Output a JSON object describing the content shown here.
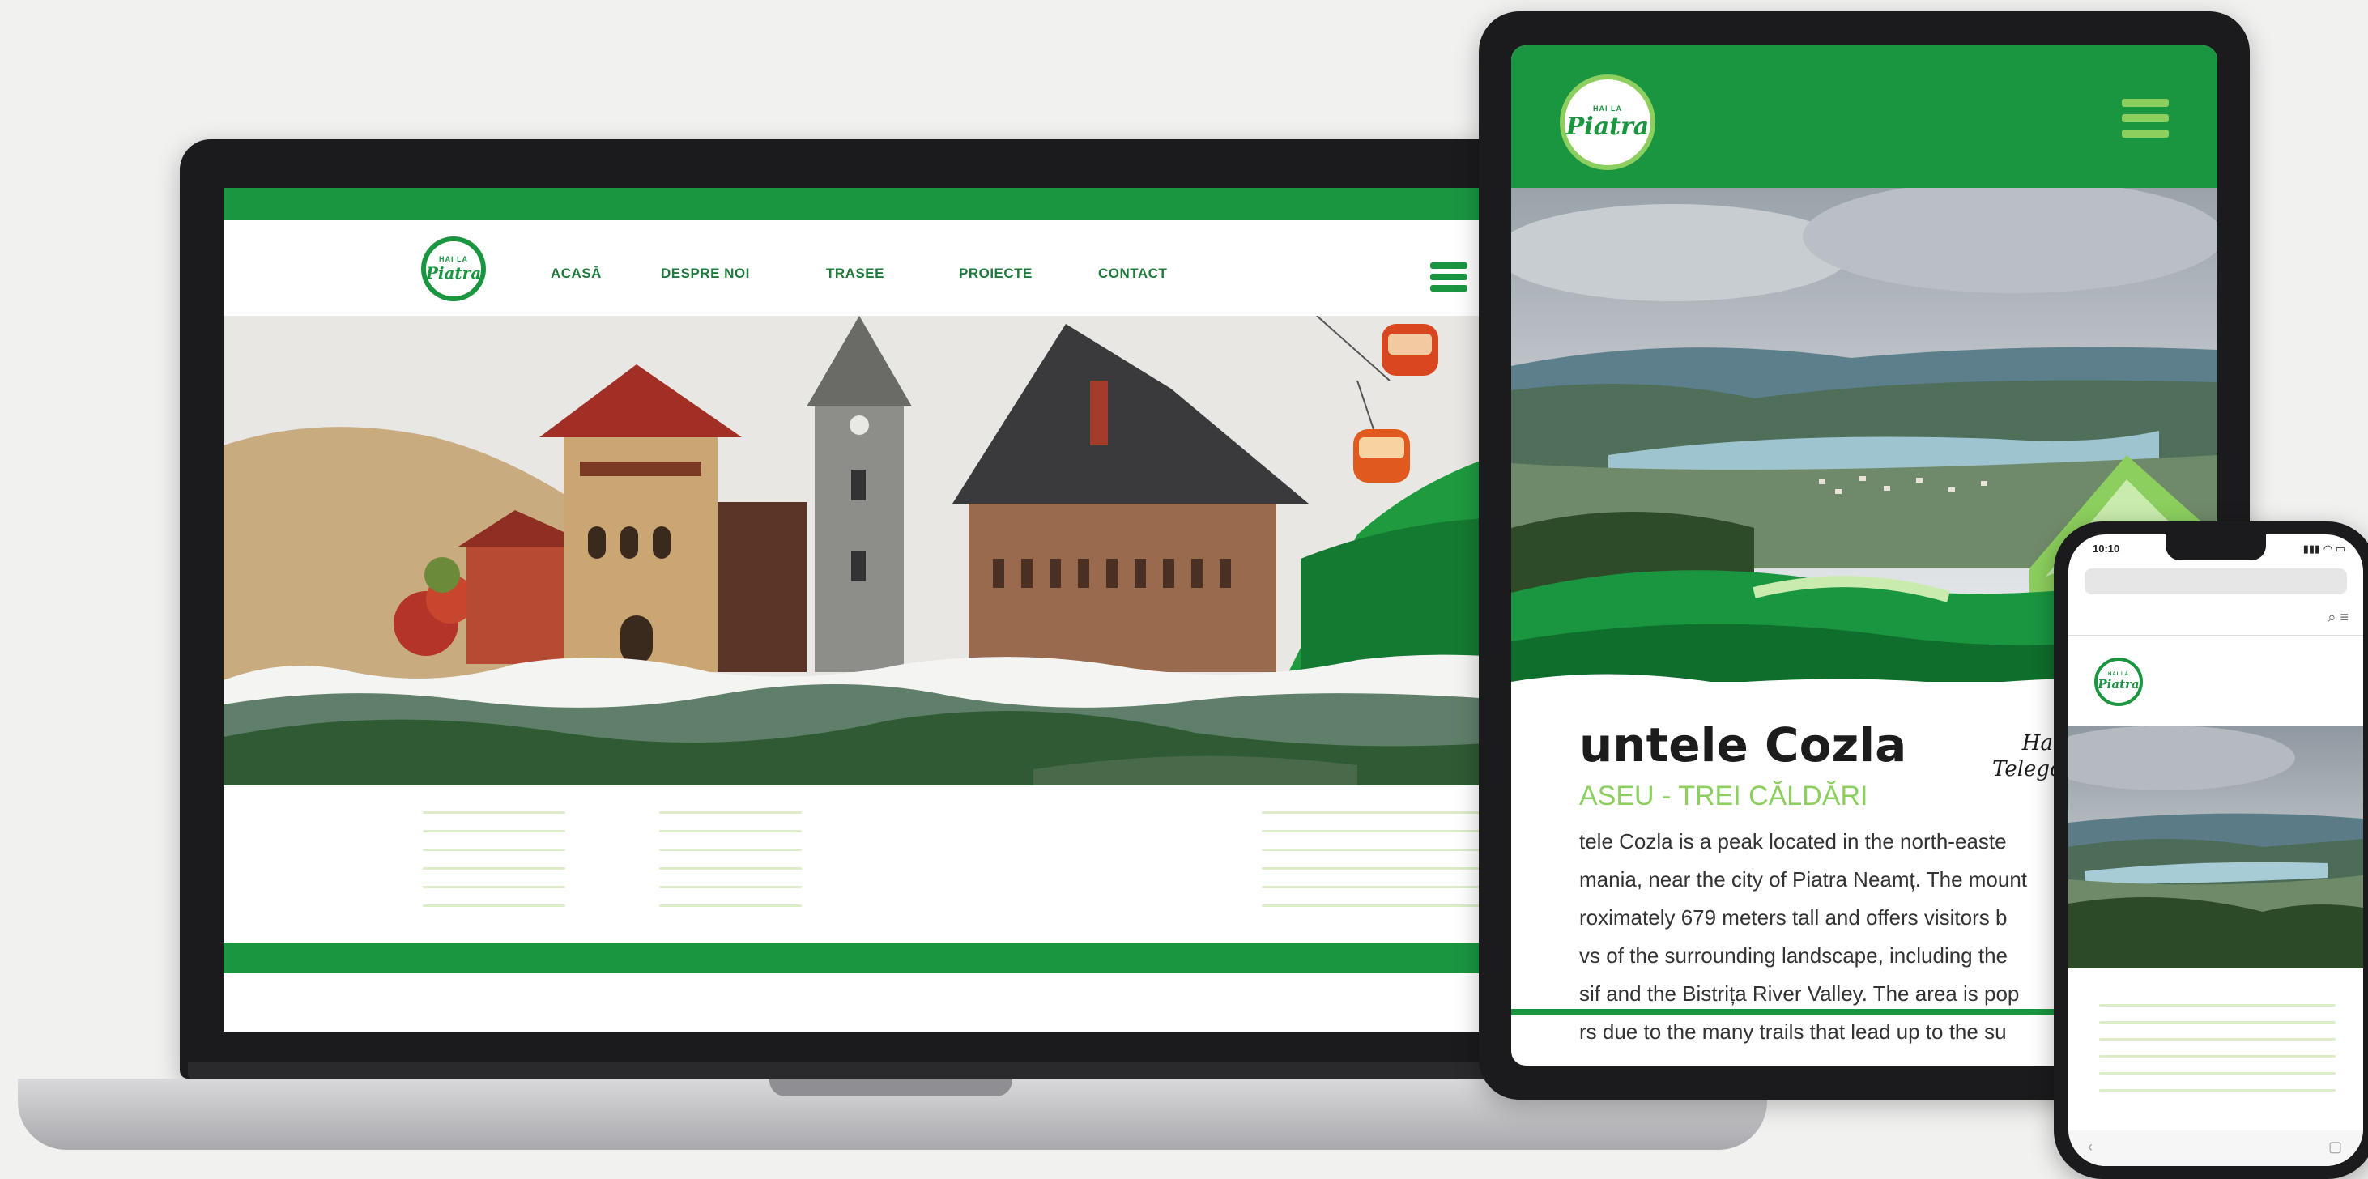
{
  "laptop": {
    "logo": {
      "small": "HAI LA",
      "big": "Piatra"
    },
    "nav": [
      "ACASĂ",
      "DESPRE NOI",
      "TRASEE",
      "PROIECTE",
      "CONTACT"
    ]
  },
  "tablet": {
    "logo": {
      "small": "HAI LA",
      "big": "Piatra"
    },
    "title": "untele Cozla",
    "subtitle": "ASEU - TREI CĂLDĂRI",
    "signature_line1": "Hai",
    "signature_line2": "Telegond",
    "body": [
      "tele Cozla is a peak located in the north-easte",
      "mania, near the city of Piatra Neamț. The mount",
      "roximately 679 meters tall and offers visitors b",
      "vs of the surrounding landscape, including the",
      "sif and the Bistrița River Valley. The area is pop",
      "rs due to the many trails that lead up to the su"
    ]
  },
  "phone": {
    "time": "10:10",
    "status": "▮▮▮ ◠ ▭",
    "logo": {
      "small": "HAI LA",
      "big": "Piatra"
    }
  },
  "colors": {
    "brand_green": "#1a9640",
    "light_green": "#8ccf5e",
    "line_green": "#dcedc7"
  }
}
